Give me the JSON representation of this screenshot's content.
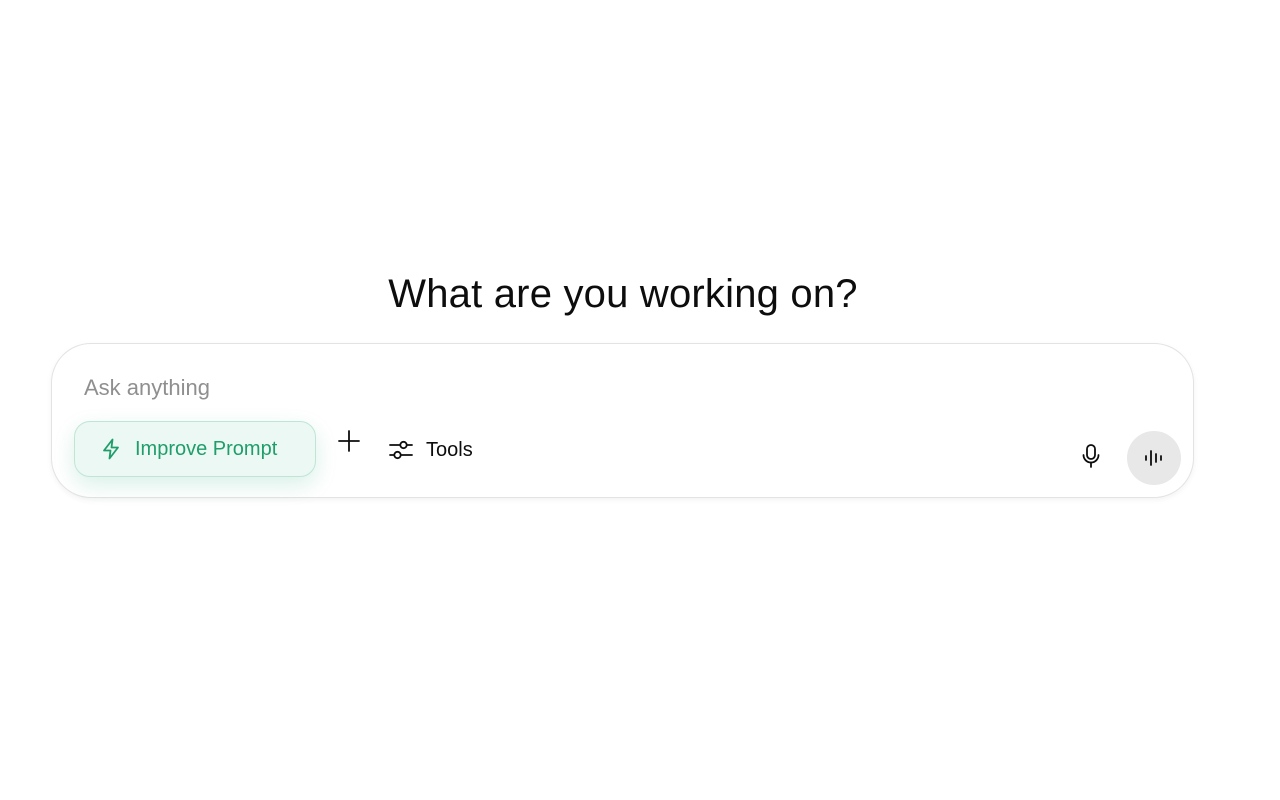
{
  "main": {
    "heading": "What are you working on?"
  },
  "composer": {
    "placeholder": "Ask anything",
    "improve_prompt_label": "Improve Prompt",
    "tools_label": "Tools"
  },
  "icons": {
    "improve": "lightning-bolt-icon",
    "add": "plus-icon",
    "tools": "sliders-icon",
    "dictate": "microphone-icon",
    "voice": "voice-waveform-icon"
  },
  "colors": {
    "accent": "#1f9e6b",
    "accent_bg": "#ecf8f3",
    "voice_bg": "#e8e8e8"
  }
}
